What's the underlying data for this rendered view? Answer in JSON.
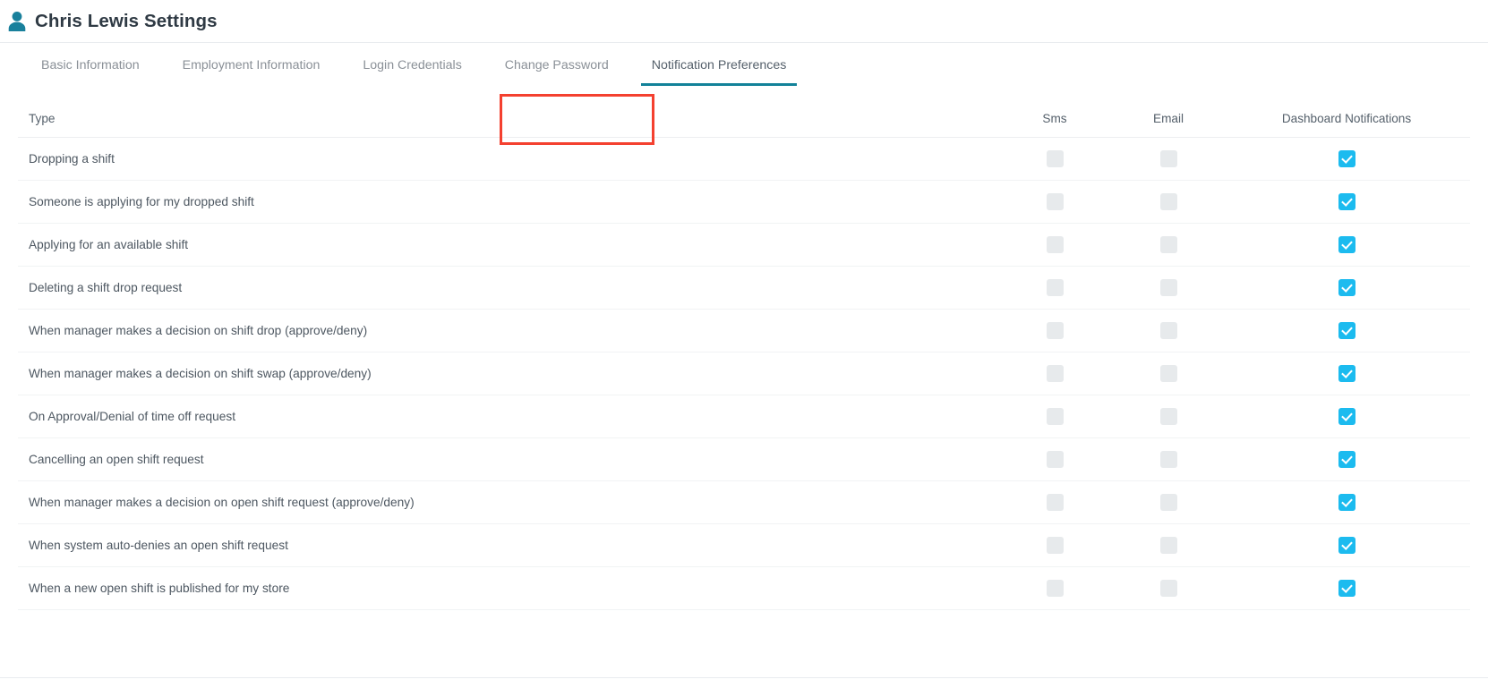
{
  "header": {
    "title": "Chris Lewis Settings",
    "icon": "user-icon"
  },
  "tabs": [
    {
      "label": "Basic Information",
      "active": false
    },
    {
      "label": "Employment Information",
      "active": false
    },
    {
      "label": "Login Credentials",
      "active": false
    },
    {
      "label": "Change Password",
      "active": false
    },
    {
      "label": "Notification Preferences",
      "active": true
    }
  ],
  "annotation": {
    "target_tab": "Notification Preferences",
    "color": "#f4402f"
  },
  "colors": {
    "accent_teal": "#128299",
    "checkbox_checked": "#1cbbef",
    "checkbox_unchecked": "#e7eaec",
    "annotation_red": "#f4402f",
    "icon_teal": "#19809c"
  },
  "table": {
    "columns": [
      "Type",
      "Sms",
      "Email",
      "Dashboard Notifications"
    ],
    "rows": [
      {
        "type": "Dropping a shift",
        "sms": false,
        "email": false,
        "dashboard": true
      },
      {
        "type": "Someone is applying for my dropped shift",
        "sms": false,
        "email": false,
        "dashboard": true
      },
      {
        "type": "Applying for an available shift",
        "sms": false,
        "email": false,
        "dashboard": true
      },
      {
        "type": "Deleting a shift drop request",
        "sms": false,
        "email": false,
        "dashboard": true
      },
      {
        "type": "When manager makes a decision on shift drop (approve/deny)",
        "sms": false,
        "email": false,
        "dashboard": true
      },
      {
        "type": "When manager makes a decision on shift swap (approve/deny)",
        "sms": false,
        "email": false,
        "dashboard": true
      },
      {
        "type": "On Approval/Denial of time off request",
        "sms": false,
        "email": false,
        "dashboard": true
      },
      {
        "type": "Cancelling an open shift request",
        "sms": false,
        "email": false,
        "dashboard": true
      },
      {
        "type": "When manager makes a decision on open shift request (approve/deny)",
        "sms": false,
        "email": false,
        "dashboard": true
      },
      {
        "type": "When system auto-denies an open shift request",
        "sms": false,
        "email": false,
        "dashboard": true
      },
      {
        "type": "When a new open shift is published for my store",
        "sms": false,
        "email": false,
        "dashboard": true
      }
    ]
  }
}
